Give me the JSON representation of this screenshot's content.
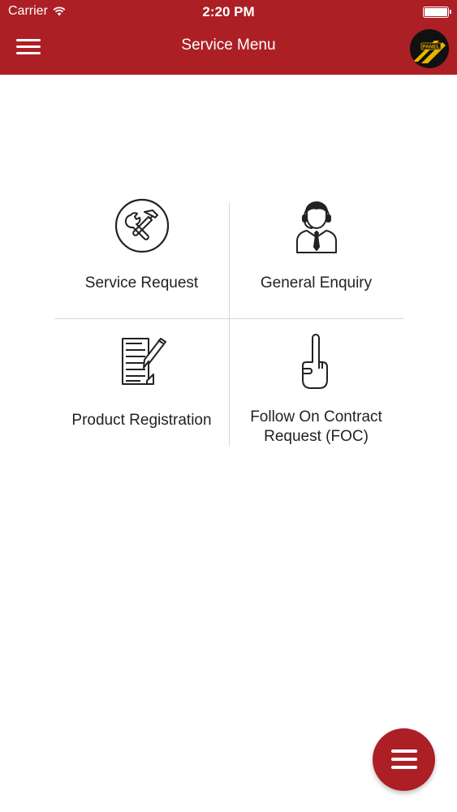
{
  "status_bar": {
    "carrier": "Carrier",
    "time": "2:20 PM",
    "battery_level": 1.0
  },
  "header": {
    "title": "Service Menu",
    "menu_icon": "hamburger-icon",
    "logo_icon": "brand-logo-icon",
    "logo_text": "PANEL"
  },
  "menu": {
    "items": [
      {
        "label": "Service Request",
        "icon": "tools-icon"
      },
      {
        "label": "General Enquiry",
        "icon": "support-agent-icon"
      },
      {
        "label": "Product Registration",
        "icon": "document-edit-icon"
      },
      {
        "label": "Follow On Contract Request (FOC)",
        "label_line1": "Follow On Contract",
        "label_line2": "Request (FOC)",
        "icon": "pointing-hand-icon"
      }
    ]
  },
  "fab": {
    "icon": "hamburger-icon"
  },
  "colors": {
    "primary": "#ac1f25",
    "divider": "#d7d7d7",
    "text": "#222222"
  }
}
